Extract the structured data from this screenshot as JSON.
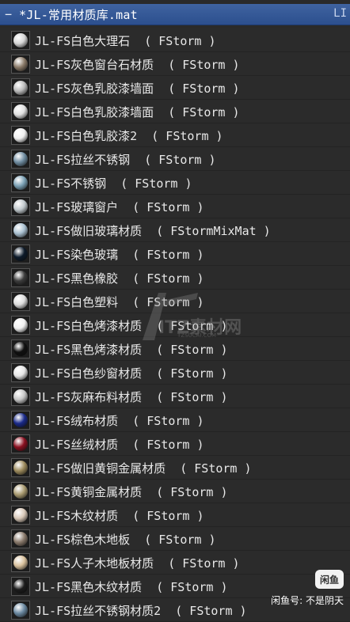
{
  "header": {
    "collapse_symbol": "−",
    "title": "*JL-常用材质库.mat",
    "right_label": "LI"
  },
  "materials": [
    {
      "label": "JL-FS白色大理石  ( FStorm )",
      "color": "#d6d6d6"
    },
    {
      "label": "JL-FS灰色窗台石材质  ( FStorm )",
      "color": "#8a7a68"
    },
    {
      "label": "JL-FS灰色乳胶漆墙面  ( FStorm )",
      "color": "#b9b9b9"
    },
    {
      "label": "JL-FS白色乳胶漆墙面  ( FStorm )",
      "color": "#e0e0e0"
    },
    {
      "label": "JL-FS白色乳胶漆2  ( FStorm )",
      "color": "#efefef"
    },
    {
      "label": "JL-FS拉丝不锈钢  ( FStorm )",
      "color": "#6f8ca0"
    },
    {
      "label": "JL-FS不锈钢  ( FStorm )",
      "color": "#7aa0b4"
    },
    {
      "label": "JL-FS玻璃窗户  ( FStorm )",
      "color": "#c0c8cc"
    },
    {
      "label": "JL-FS做旧玻璃材质  ( FStormMixMat )",
      "color": "#a9c0d0"
    },
    {
      "label": "JL-FS染色玻璃  ( FStorm )",
      "color": "#0c1a2a"
    },
    {
      "label": "JL-FS黑色橡胶  ( FStorm )",
      "color": "#3c3c3c"
    },
    {
      "label": "JL-FS白色塑料  ( FStorm )",
      "color": "#dcdcdc"
    },
    {
      "label": "JL-FS白色烤漆材质  ( FStorm )",
      "color": "#f0f0f0"
    },
    {
      "label": "JL-FS黑色烤漆材质  ( FStorm )",
      "color": "#101010"
    },
    {
      "label": "JL-FS白色纱窗材质  ( FStorm )",
      "color": "#e6e6e6"
    },
    {
      "label": "JL-FS灰麻布料材质  ( FStorm )",
      "color": "#c6c6c6"
    },
    {
      "label": "JL-FS绒布材质  ( FStorm )",
      "color": "#1a2a8a"
    },
    {
      "label": "JL-FS丝绒材质  ( FStorm )",
      "color": "#8a1020"
    },
    {
      "label": "JL-FS做旧黄铜金属材质  ( FStorm )",
      "color": "#9c8a5c"
    },
    {
      "label": "JL-FS黄铜金属材质  ( FStorm )",
      "color": "#a89a70"
    },
    {
      "label": "JL-FS木纹材质  ( FStorm )",
      "color": "#d8c8b8"
    },
    {
      "label": "JL-FS棕色木地板  ( FStorm )",
      "color": "#8a7a6c"
    },
    {
      "label": "JL-FS人子木地板材质  ( FStorm )",
      "color": "#d8c09c"
    },
    {
      "label": "JL-FS黑色木纹材质  ( FStorm )",
      "color": "#1c1c1c"
    },
    {
      "label": "JL-FS拉丝不锈钢材质2  ( FStorm )",
      "color": "#6a88a0"
    }
  ],
  "watermark": {
    "big": "ITZ素材网",
    "small": "TZSUCAI.COM"
  },
  "corner_badge": "闲鱼",
  "corner_text": "闲鱼号: 不是阴天"
}
